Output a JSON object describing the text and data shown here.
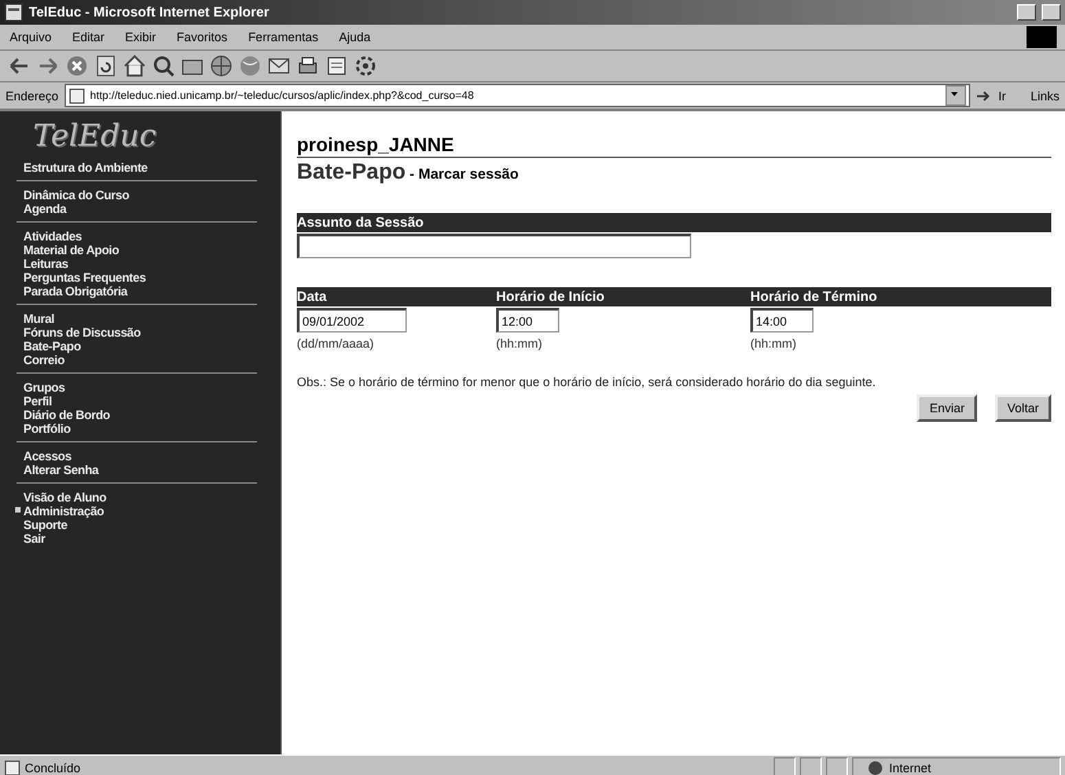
{
  "window": {
    "title": "TelEduc - Microsoft Internet Explorer"
  },
  "menu": [
    "Arquivo",
    "Editar",
    "Exibir",
    "Favoritos",
    "Ferramentas",
    "Ajuda"
  ],
  "address": {
    "label": "Endereço",
    "value": "http://teleduc.nied.unicamp.br/~teleduc/cursos/aplic/index.php?&cod_curso=48",
    "go": "Ir",
    "links": "Links"
  },
  "sidebar": {
    "logo": "TelEduc",
    "groups": [
      [
        {
          "label": "Estrutura do Ambiente",
          "marked": false
        }
      ],
      [
        {
          "label": "Dinâmica do Curso",
          "marked": false
        },
        {
          "label": "Agenda",
          "marked": false
        }
      ],
      [
        {
          "label": "Atividades",
          "marked": false
        },
        {
          "label": "Material de Apoio",
          "marked": false
        },
        {
          "label": "Leituras",
          "marked": false
        },
        {
          "label": "Perguntas Frequentes",
          "marked": false
        },
        {
          "label": "Parada Obrigatória",
          "marked": false
        }
      ],
      [
        {
          "label": "Mural",
          "marked": false
        },
        {
          "label": "Fóruns de Discussão",
          "marked": false
        },
        {
          "label": "Bate-Papo",
          "marked": false
        },
        {
          "label": "Correio",
          "marked": false
        }
      ],
      [
        {
          "label": "Grupos",
          "marked": false
        },
        {
          "label": "Perfil",
          "marked": false
        },
        {
          "label": "Diário de Bordo",
          "marked": false
        },
        {
          "label": "Portfólio",
          "marked": false
        }
      ],
      [
        {
          "label": "Acessos",
          "marked": false
        },
        {
          "label": "Alterar Senha",
          "marked": false
        }
      ],
      [
        {
          "label": "Visão de Aluno",
          "marked": false
        },
        {
          "label": "Administração",
          "marked": true
        },
        {
          "label": "Suporte",
          "marked": false
        },
        {
          "label": "Sair",
          "marked": false
        }
      ]
    ]
  },
  "content": {
    "course": "proinesp_JANNE",
    "tool": "Bate-Papo",
    "subtitle": " - Marcar sessão",
    "subject": {
      "label": "Assunto da Sessão"
    },
    "fields": [
      {
        "label": "Data",
        "value": "09/01/2002",
        "hint": "(dd/mm/aaaa)"
      },
      {
        "label": "Horário de Início",
        "value": "12:00",
        "hint": "(hh:mm)"
      },
      {
        "label": "Horário de Término",
        "value": "14:00",
        "hint": "(hh:mm)"
      }
    ],
    "note": "Obs.: Se o horário de término for menor que o horário de início, será considerado horário do dia seguinte.",
    "buttons": [
      "Enviar",
      "Voltar"
    ]
  },
  "status_bar": {
    "text": "Concluído",
    "zone": "Internet"
  }
}
